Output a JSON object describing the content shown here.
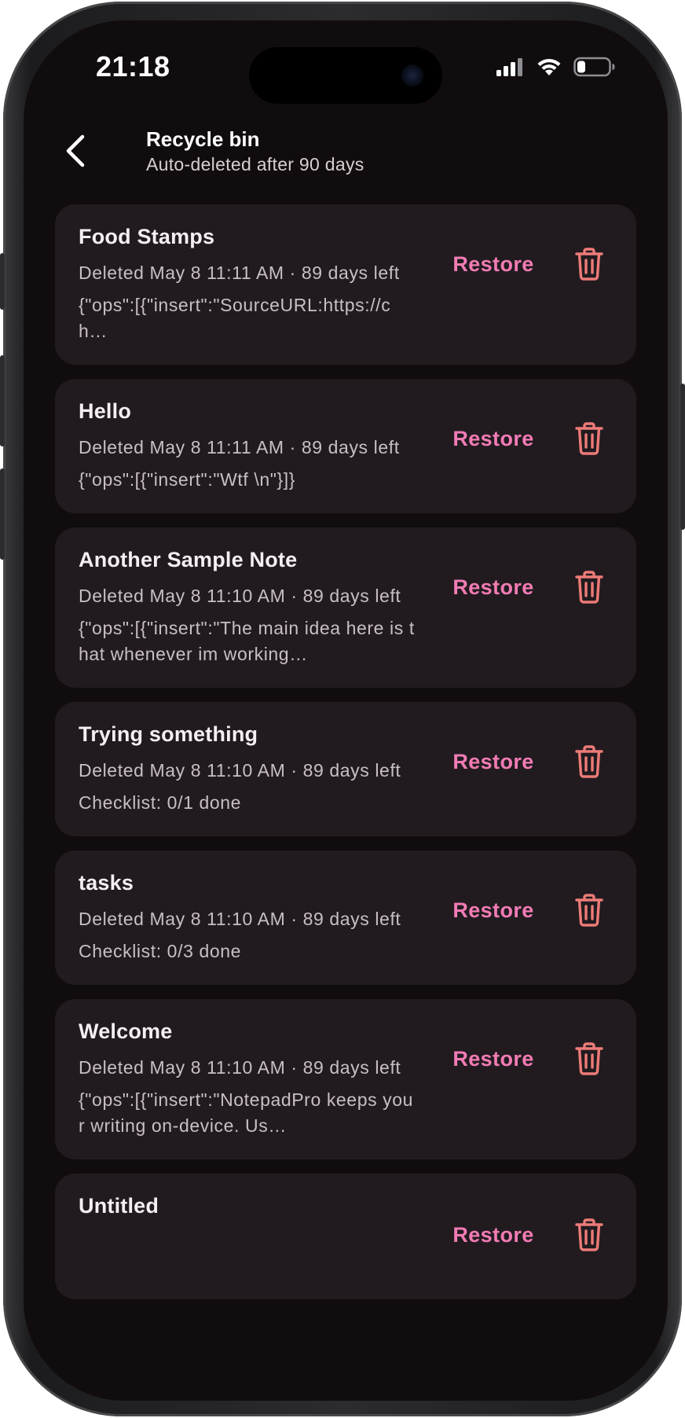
{
  "status_bar": {
    "time": "21:18",
    "icons": [
      "cellular-signal-icon",
      "wifi-icon",
      "battery-icon"
    ]
  },
  "header": {
    "back_icon": "chevron-left-icon",
    "title": "Recycle bin",
    "subtitle": "Auto-deleted after 90 days"
  },
  "colors": {
    "background": "#110d0f",
    "card": "#211b1f",
    "restore_accent": "#f27bb4",
    "delete_accent": "#ee7b78"
  },
  "notes": [
    {
      "title": "Food Stamps",
      "meta": "Deleted May 8 11:11 AM · 89 days left",
      "preview": "{\"ops\":[{\"insert\":\"SourceURL:https://ch…",
      "restore_label": "Restore",
      "delete_icon": "trash-icon"
    },
    {
      "title": "Hello",
      "meta": "Deleted May 8 11:11 AM · 89 days left",
      "preview": "{\"ops\":[{\"insert\":\"Wtf \\n\"}]}",
      "restore_label": "Restore",
      "delete_icon": "trash-icon"
    },
    {
      "title": "Another Sample Note",
      "meta": "Deleted May 8 11:10 AM · 89 days left",
      "preview": "{\"ops\":[{\"insert\":\"The main idea here is that whenever im working…",
      "restore_label": "Restore",
      "delete_icon": "trash-icon"
    },
    {
      "title": "Trying something",
      "meta": "Deleted May 8 11:10 AM · 89 days left",
      "preview": "Checklist: 0/1 done",
      "restore_label": "Restore",
      "delete_icon": "trash-icon"
    },
    {
      "title": "tasks",
      "meta": "Deleted May 8 11:10 AM · 89 days left",
      "preview": "Checklist: 0/3 done",
      "restore_label": "Restore",
      "delete_icon": "trash-icon"
    },
    {
      "title": "Welcome",
      "meta": "Deleted May 8 11:10 AM · 89 days left",
      "preview": "{\"ops\":[{\"insert\":\"NotepadPro keeps your writing on-device. Us…",
      "restore_label": "Restore",
      "delete_icon": "trash-icon"
    },
    {
      "title": "Untitled",
      "meta": "",
      "preview": "",
      "restore_label": "Restore",
      "delete_icon": "trash-icon"
    }
  ]
}
